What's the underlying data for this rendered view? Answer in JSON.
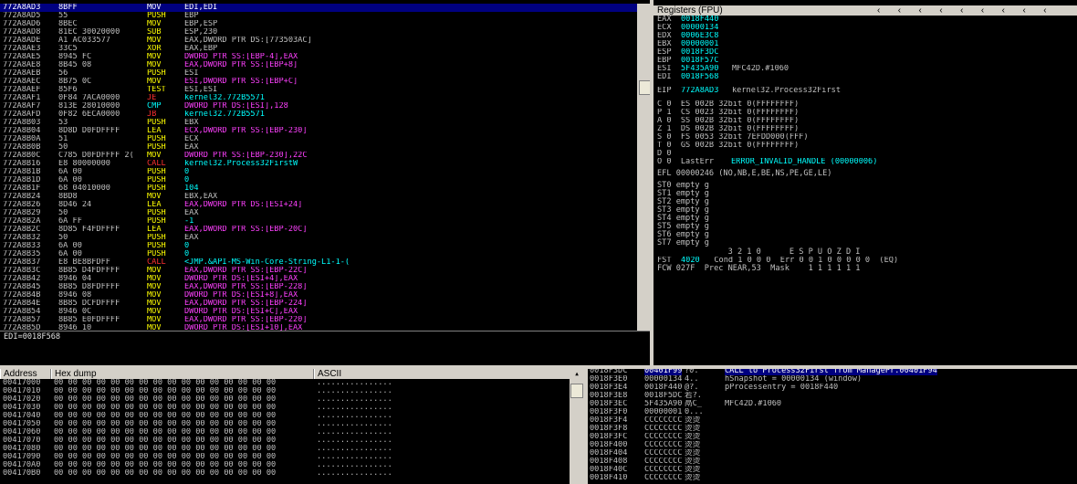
{
  "disasm": {
    "rows": [
      {
        "addr": "772A8AD3",
        "hex": "8BFF",
        "mn": "MOV",
        "ops": "EDI,EDI",
        "k": "mov",
        "sel": true
      },
      {
        "addr": "772A8AD5",
        "hex": "55",
        "mn": "PUSH",
        "ops": "EBP",
        "k": "push"
      },
      {
        "addr": "772A8AD6",
        "hex": "8BEC",
        "mn": "MOV",
        "ops": "EBP,ESP",
        "k": "mov"
      },
      {
        "addr": "772A8AD8",
        "hex": "81EC 30020000",
        "mn": "SUB",
        "ops": "ESP,230",
        "k": "sub"
      },
      {
        "addr": "772A8ADE",
        "hex": "A1 AC033577",
        "mn": "MOV",
        "ops": "EAX,DWORD PTR DS:[773503AC]",
        "k": "mov"
      },
      {
        "addr": "772A8AE3",
        "hex": "33C5",
        "mn": "XOR",
        "ops": "EAX,EBP",
        "k": "xor"
      },
      {
        "addr": "772A8AE5",
        "hex": "8945 FC",
        "mn": "MOV",
        "ops": "DWORD PTR SS:[EBP-4],EAX",
        "k": "mem"
      },
      {
        "addr": "772A8AE8",
        "hex": "8B45 08",
        "mn": "MOV",
        "ops": "EAX,DWORD PTR SS:[EBP+8]",
        "k": "mem"
      },
      {
        "addr": "772A8AEB",
        "hex": "56",
        "mn": "PUSH",
        "ops": "ESI",
        "k": "push"
      },
      {
        "addr": "772A8AEC",
        "hex": "8B75 0C",
        "mn": "MOV",
        "ops": "ESI,DWORD PTR SS:[EBP+C]",
        "k": "mem"
      },
      {
        "addr": "772A8AEF",
        "hex": "85F6",
        "mn": "TEST",
        "ops": "ESI,ESI",
        "k": "test"
      },
      {
        "addr": "772A8AF1",
        "hex": "0F84 7ACA0000",
        "mn": "JE",
        "ops": "kernel32.772B5571",
        "k": "jmp"
      },
      {
        "addr": "772A8AF7",
        "hex": "813E 28010000",
        "mn": "CMP",
        "ops": "DWORD PTR DS:[ESI],128",
        "k": "cmp"
      },
      {
        "addr": "772A8AFD",
        "hex": "0F82 6ECA0000",
        "mn": "JB",
        "ops": "kernel32.772B5571",
        "k": "jmp"
      },
      {
        "addr": "772A8B03",
        "hex": "53",
        "mn": "PUSH",
        "ops": "EBX",
        "k": "push"
      },
      {
        "addr": "772A8B04",
        "hex": "8D8D D0FDFFFF",
        "mn": "LEA",
        "ops": "ECX,DWORD PTR SS:[EBP-230]",
        "k": "mem"
      },
      {
        "addr": "772A8B0A",
        "hex": "51",
        "mn": "PUSH",
        "ops": "ECX",
        "k": "push"
      },
      {
        "addr": "772A8B0B",
        "hex": "50",
        "mn": "PUSH",
        "ops": "EAX",
        "k": "push"
      },
      {
        "addr": "772A8B0C",
        "hex": "C785 D0FDFFFF 2(",
        "mn": "MOV",
        "ops": "DWORD PTR SS:[EBP-230],22C",
        "k": "mem"
      },
      {
        "addr": "772A8B16",
        "hex": "E8 80000000",
        "mn": "CALL",
        "ops": "kernel32.Process32FirstW",
        "k": "call"
      },
      {
        "addr": "772A8B1B",
        "hex": "6A 00",
        "mn": "PUSH",
        "ops": "0",
        "k": "push"
      },
      {
        "addr": "772A8B1D",
        "hex": "6A 00",
        "mn": "PUSH",
        "ops": "0",
        "k": "push"
      },
      {
        "addr": "772A8B1F",
        "hex": "68 04010000",
        "mn": "PUSH",
        "ops": "104",
        "k": "push"
      },
      {
        "addr": "772A8B24",
        "hex": "8BD8",
        "mn": "MOV",
        "ops": "EBX,EAX",
        "k": "mov"
      },
      {
        "addr": "772A8B26",
        "hex": "8D46 24",
        "mn": "LEA",
        "ops": "EAX,DWORD PTR DS:[ESI+24]",
        "k": "mem"
      },
      {
        "addr": "772A8B29",
        "hex": "50",
        "mn": "PUSH",
        "ops": "EAX",
        "k": "push"
      },
      {
        "addr": "772A8B2A",
        "hex": "6A FF",
        "mn": "PUSH",
        "ops": "-1",
        "k": "push"
      },
      {
        "addr": "772A8B2C",
        "hex": "8D85 F4FDFFFF",
        "mn": "LEA",
        "ops": "EAX,DWORD PTR SS:[EBP-20C]",
        "k": "mem"
      },
      {
        "addr": "772A8B32",
        "hex": "50",
        "mn": "PUSH",
        "ops": "EAX",
        "k": "push"
      },
      {
        "addr": "772A8B33",
        "hex": "6A 00",
        "mn": "PUSH",
        "ops": "0",
        "k": "push"
      },
      {
        "addr": "772A8B35",
        "hex": "6A 00",
        "mn": "PUSH",
        "ops": "0",
        "k": "push"
      },
      {
        "addr": "772A8B37",
        "hex": "E8 BE8BFDFF",
        "mn": "CALL",
        "ops": "<JMP.&API-MS-Win-Core-String-L1-1-(",
        "k": "call"
      },
      {
        "addr": "772A8B3C",
        "hex": "8B85 D4FDFFFF",
        "mn": "MOV",
        "ops": "EAX,DWORD PTR SS:[EBP-22C]",
        "k": "mem"
      },
      {
        "addr": "772A8B42",
        "hex": "8946 04",
        "mn": "MOV",
        "ops": "DWORD PTR DS:[ESI+4],EAX",
        "k": "mem"
      },
      {
        "addr": "772A8B45",
        "hex": "8B85 D8FDFFFF",
        "mn": "MOV",
        "ops": "EAX,DWORD PTR SS:[EBP-228]",
        "k": "mem"
      },
      {
        "addr": "772A8B4B",
        "hex": "8946 08",
        "mn": "MOV",
        "ops": "DWORD PTR DS:[ESI+8],EAX",
        "k": "mem"
      },
      {
        "addr": "772A8B4E",
        "hex": "8B85 DCFDFFFF",
        "mn": "MOV",
        "ops": "EAX,DWORD PTR SS:[EBP-224]",
        "k": "mem"
      },
      {
        "addr": "772A8B54",
        "hex": "8946 0C",
        "mn": "MOV",
        "ops": "DWORD PTR DS:[ESI+C],EAX",
        "k": "mem"
      },
      {
        "addr": "772A8B57",
        "hex": "8B85 E0FDFFFF",
        "mn": "MOV",
        "ops": "EAX,DWORD PTR SS:[EBP-220]",
        "k": "mem"
      },
      {
        "addr": "772A8B5D",
        "hex": "8946 10",
        "mn": "MOV",
        "ops": "DWORD PTR DS:[ESI+10],EAX",
        "k": "mem"
      }
    ]
  },
  "info": {
    "text": "EDI=0018F568"
  },
  "registers": {
    "title": "Registers (FPU)",
    "gp": [
      {
        "n": "EAX",
        "v": "0018F440",
        "x": ""
      },
      {
        "n": "ECX",
        "v": "00000134",
        "x": ""
      },
      {
        "n": "EDX",
        "v": "0006E3C8",
        "x": ""
      },
      {
        "n": "EBX",
        "v": "00000001",
        "x": ""
      },
      {
        "n": "ESP",
        "v": "0018F3DC",
        "x": ""
      },
      {
        "n": "EBP",
        "v": "0018F57C",
        "x": ""
      },
      {
        "n": "ESI",
        "v": "5F435A90",
        "x": "MFC42D.#1060"
      },
      {
        "n": "EDI",
        "v": "0018F568",
        "x": ""
      }
    ],
    "eip": {
      "n": "EIP",
      "v": "772A8AD3",
      "x": "kernel32.Process32First"
    },
    "flags": [
      "C 0  ES 002B 32bit 0(FFFFFFFF)",
      "P 1  CS 0023 32bit 0(FFFFFFFF)",
      "A 0  SS 002B 32bit 0(FFFFFFFF)",
      "Z 1  DS 002B 32bit 0(FFFFFFFF)",
      "S 0  FS 0053 32bit 7EFDD000(FFF)",
      "T 0  GS 002B 32bit 0(FFFFFFFF)",
      "D 0",
      "O 0  LastErr "
    ],
    "lasterr": "ERROR_INVALID_HANDLE (00000006)",
    "efl": "EFL 00000246 (NO,NB,E,BE,NS,PE,GE,LE)",
    "st": [
      "ST0 empty g",
      "ST1 empty g",
      "ST2 empty g",
      "ST3 empty g",
      "ST4 empty g",
      "ST5 empty g",
      "ST6 empty g",
      "ST7 empty g"
    ],
    "fpu_hdr": "               3 2 1 0      E S P U O Z D I",
    "fst_label": "FST ",
    "fst_val": "4020",
    "fst_rest": "  Cond 1 0 0 0  Err 0 0 1 0 0 0 0 0  (EQ)",
    "fcw": "FCW 027F  Prec NEAR,53  Mask    1 1 1 1 1 1"
  },
  "dump": {
    "col_address": "Address",
    "col_hex": "Hex dump",
    "col_ascii": "ASCII",
    "rows": [
      "00417000",
      "00417010",
      "00417020",
      "00417030",
      "00417040",
      "00417050",
      "00417060",
      "00417070",
      "00417080",
      "00417090",
      "004170A0",
      "004170B0"
    ],
    "hex": "00 00 00 00 00 00 00 00 00 00 00 00 00 00 00 00",
    "ascii": "................"
  },
  "stack": {
    "rows": [
      {
        "a": "0018F3DC",
        "v": "00401F99",
        "t": "?0.",
        "c": "CALL to Process32First from ManagePr.00401F94",
        "sel": true
      },
      {
        "a": "0018F3E0",
        "v": "00000134",
        "t": "4..",
        "c": "hSnapshot = 00000134 (window)"
      },
      {
        "a": "0018F3E4",
        "v": "0018F440",
        "t": "@?.",
        "c": "pProcessentry = 0018F440"
      },
      {
        "a": "0018F3E8",
        "v": "0018F5DC",
        "t": "若?.",
        "c": ""
      },
      {
        "a": "0018F3EC",
        "v": "5F435A90",
        "t": "鬲C_",
        "c": "MFC42D.#1060"
      },
      {
        "a": "0018F3F0",
        "v": "00000001",
        "t": "0...",
        "c": ""
      },
      {
        "a": "0018F3F4",
        "v": "CCCCCCCC",
        "t": "烫烫",
        "c": ""
      },
      {
        "a": "0018F3F8",
        "v": "CCCCCCCC",
        "t": "烫烫",
        "c": ""
      },
      {
        "a": "0018F3FC",
        "v": "CCCCCCCC",
        "t": "烫烫",
        "c": ""
      },
      {
        "a": "0018F400",
        "v": "CCCCCCCC",
        "t": "烫烫",
        "c": ""
      },
      {
        "a": "0018F404",
        "v": "CCCCCCCC",
        "t": "烫烫",
        "c": ""
      },
      {
        "a": "0018F408",
        "v": "CCCCCCCC",
        "t": "烫烫",
        "c": ""
      },
      {
        "a": "0018F40C",
        "v": "CCCCCCCC",
        "t": "烫烫",
        "c": ""
      },
      {
        "a": "0018F410",
        "v": "CCCCCCCC",
        "t": "烫烫",
        "c": ""
      }
    ]
  }
}
